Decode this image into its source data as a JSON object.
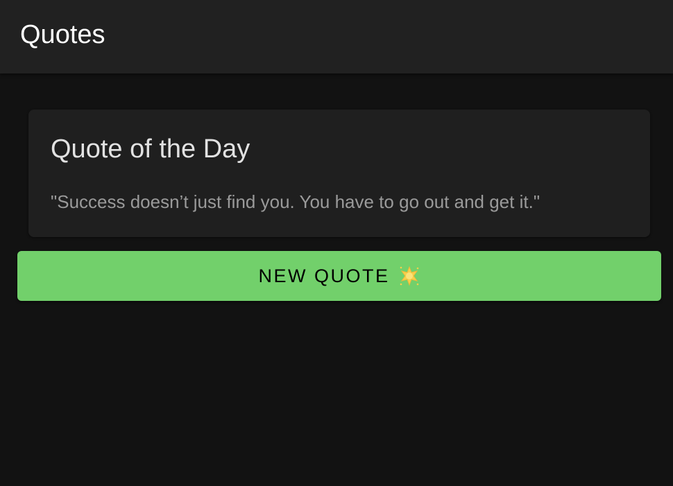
{
  "app_bar": {
    "title": "Quotes"
  },
  "card": {
    "title": "Quote of the Day",
    "quote": "\"Success doesn’t just find you. You have to go out and get it.\""
  },
  "new_quote_button": {
    "label": "NEW QUOTE",
    "icon": "glowing-star-icon"
  },
  "colors": {
    "background": "#121212",
    "app_bar": "#212121",
    "card": "#1f1f1f",
    "button": "#72d06b",
    "star": "#f5d14b"
  }
}
